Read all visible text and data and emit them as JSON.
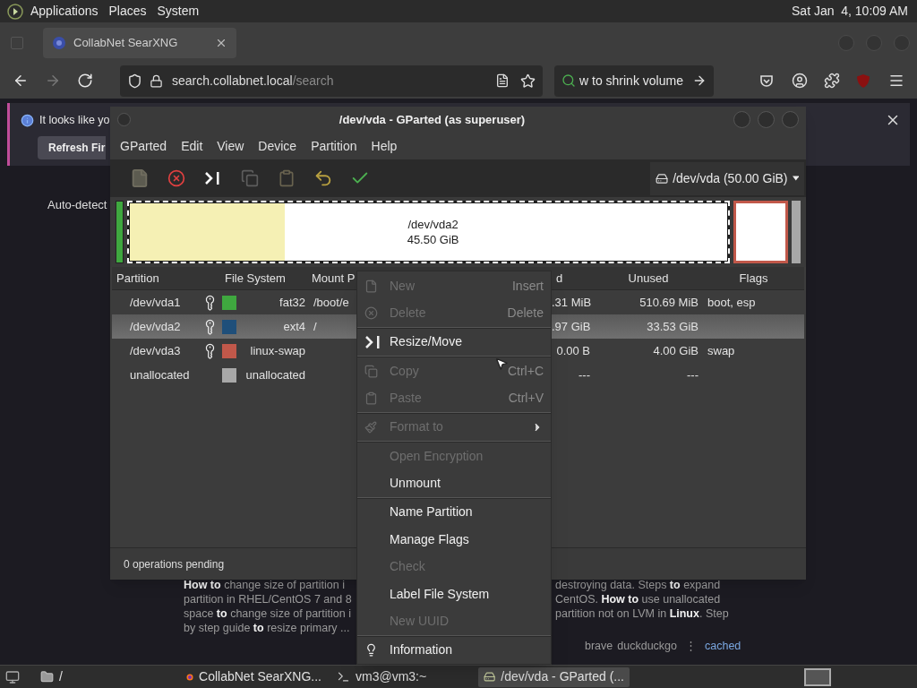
{
  "top_panel": {
    "menus": [
      "Applications",
      "Places",
      "System"
    ],
    "clock": "Sat Jan  4, 10:09 AM"
  },
  "browser": {
    "tabs": [
      {
        "title": "CollabNet SearXNG",
        "selected": true
      }
    ],
    "nav_buttons": [
      {
        "disabled": false
      },
      {
        "disabled": true
      },
      {
        "disabled": false
      }
    ],
    "url": {
      "domain": "search.collabnet.local",
      "path": "/search"
    },
    "search_field": {
      "value": "w to shrink volume"
    },
    "notification": {
      "text": "It looks like yo",
      "button": "Refresh Fir"
    },
    "page": {
      "sidebar_label": "Auto-detect",
      "snippet_lines": [
        {
          "left": "**How to** change size of partition i",
          "right": "destroying data. Steps **to** expand"
        },
        {
          "left": "partition in RHEL/CentOS 7 and 8",
          "right": "CentOS. **How to** use unallocated"
        },
        {
          "left": "space **to** change size of partition i",
          "right": "partition not on LVM in **Linux**. Step"
        },
        {
          "left": "by step guide **to** resize primary ..."
        }
      ],
      "engines": [
        "brave",
        "duckduckgo"
      ],
      "separator": "⋮",
      "cached_link": "cached"
    }
  },
  "gparted": {
    "title": "/dev/vda - GParted (as superuser)",
    "menu": [
      "GParted",
      "Edit",
      "View",
      "Device",
      "Partition",
      "Help"
    ],
    "toolbar": [
      {
        "disabled": true
      },
      {
        "disabled": false
      },
      {
        "disabled": false
      },
      {
        "disabled": true
      },
      {
        "disabled": true
      },
      {
        "disabled": false
      },
      {
        "disabled": false
      }
    ],
    "device": "/dev/vda (50.00 GiB)",
    "graph": {
      "label": "/dev/vda2",
      "size": "45.50 GiB",
      "level": 0.26
    },
    "columns": [
      "Partition",
      "File System",
      "Mount P",
      "d",
      "Unused",
      "Flags"
    ],
    "rows": [
      {
        "partition": "/dev/vda1",
        "mounted": true,
        "color": "#3fa83f",
        "file_system": "fat32",
        "mount_point": "/boot/e",
        "used": ".31 MiB",
        "unused": "510.69 MiB",
        "flags": "boot, esp",
        "selected": false
      },
      {
        "partition": "/dev/vda2",
        "mounted": true,
        "color": "#1f4f7a",
        "file_system": "ext4",
        "mount_point": "/",
        "used": ".97 GiB",
        "unused": "33.53 GiB",
        "selected": true
      },
      {
        "partition": "/dev/vda3",
        "mounted": true,
        "color": "#c1584a",
        "file_system": "linux-swap",
        "used": "0.00 B",
        "unused": "4.00 GiB",
        "flags": "swap",
        "selected": false
      },
      {
        "partition": "unallocated",
        "mounted": false,
        "color": "#a8a8a8",
        "file_system": "unallocated",
        "used": "---",
        "unused": "---",
        "selected": false
      }
    ],
    "status": "0 operations pending"
  },
  "context_menu": {
    "items": [
      {
        "kind": "item",
        "label": "New",
        "shortcut": "Insert",
        "disabled": true
      },
      {
        "kind": "item",
        "label": "Delete",
        "shortcut": "Delete",
        "disabled": true
      },
      {
        "kind": "separator"
      },
      {
        "kind": "item",
        "label": "Resize/Move",
        "disabled": false
      },
      {
        "kind": "separator"
      },
      {
        "kind": "item",
        "label": "Copy",
        "shortcut": "Ctrl+C",
        "disabled": true
      },
      {
        "kind": "item",
        "label": "Paste",
        "shortcut": "Ctrl+V",
        "disabled": true
      },
      {
        "kind": "separator"
      },
      {
        "kind": "item",
        "label": "Format to",
        "disabled": true,
        "submenu": true
      },
      {
        "kind": "separator"
      },
      {
        "kind": "item",
        "label": "Open Encryption",
        "disabled": true
      },
      {
        "kind": "item",
        "label": "Unmount",
        "disabled": false
      },
      {
        "kind": "separator"
      },
      {
        "kind": "item",
        "label": "Name Partition",
        "disabled": false
      },
      {
        "kind": "item",
        "label": "Manage Flags",
        "disabled": false
      },
      {
        "kind": "item",
        "label": "Check",
        "disabled": true
      },
      {
        "kind": "item",
        "label": "Label File System",
        "disabled": false
      },
      {
        "kind": "item",
        "label": "New UUID",
        "disabled": true
      },
      {
        "kind": "separator"
      },
      {
        "kind": "item",
        "label": "Information",
        "disabled": false
      }
    ]
  },
  "taskbar": {
    "items": [
      {
        "label": "/",
        "selected": false
      },
      {
        "label": "CollabNet SearXNG...",
        "selected": false
      },
      {
        "label": "vm3@vm3:~",
        "selected": false
      },
      {
        "label": "/dev/vda - GParted (...",
        "selected": true
      }
    ]
  }
}
